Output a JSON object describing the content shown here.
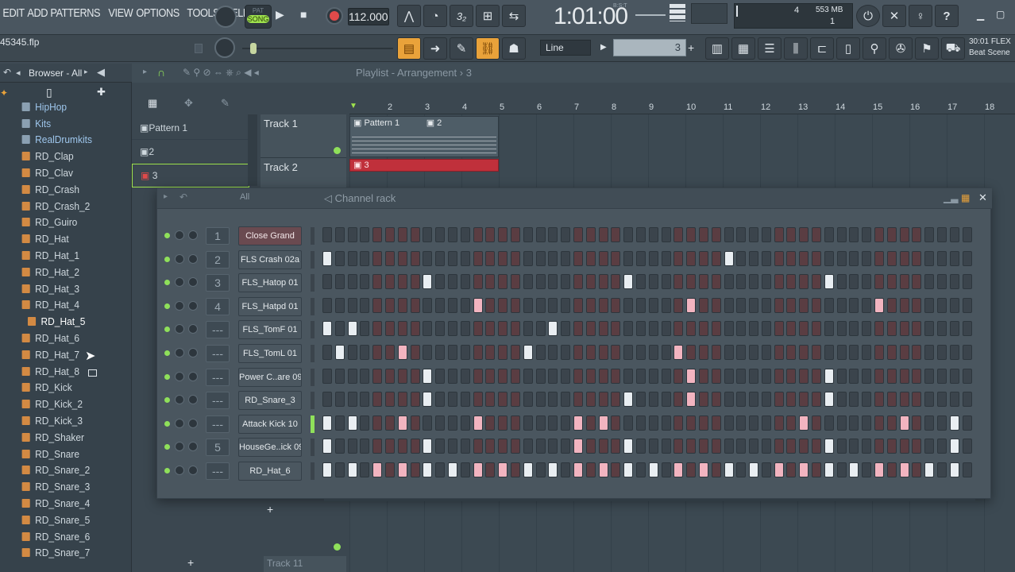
{
  "menu": [
    "EDIT",
    "ADD",
    "PATTERNS",
    "VIEW",
    "OPTIONS",
    "TOOLS",
    "HELP"
  ],
  "toolbar": {
    "pat_song": "SONG",
    "pat_label": "PAT",
    "tempo": "112.000",
    "time": "1:01:00",
    "time_sub": "B:S:T",
    "cpu_value": "4",
    "memory": "553 MB",
    "polyphony": "1",
    "snap_mode": "Line",
    "step_value": "3",
    "hint_time": "30:01",
    "hint_line1": "FLEX",
    "hint_line2": "Beat Scene",
    "file_name": "45345.flp",
    "help_label": "?"
  },
  "browser": {
    "title": "Browser - All",
    "items": [
      {
        "label": "HipHop",
        "kind": "folder"
      },
      {
        "label": "Kits",
        "kind": "folder"
      },
      {
        "label": "RealDrumkits",
        "kind": "folder"
      },
      {
        "label": "RD_Clap",
        "kind": "file"
      },
      {
        "label": "RD_Clav",
        "kind": "file"
      },
      {
        "label": "RD_Crash",
        "kind": "file"
      },
      {
        "label": "RD_Crash_2",
        "kind": "file"
      },
      {
        "label": "RD_Guiro",
        "kind": "file"
      },
      {
        "label": "RD_Hat",
        "kind": "file"
      },
      {
        "label": "RD_Hat_1",
        "kind": "file"
      },
      {
        "label": "RD_Hat_2",
        "kind": "file"
      },
      {
        "label": "RD_Hat_3",
        "kind": "file"
      },
      {
        "label": "RD_Hat_4",
        "kind": "file"
      },
      {
        "label": "RD_Hat_5",
        "kind": "selected"
      },
      {
        "label": "RD_Hat_6",
        "kind": "file"
      },
      {
        "label": "RD_Hat_7",
        "kind": "file"
      },
      {
        "label": "RD_Hat_8",
        "kind": "file"
      },
      {
        "label": "RD_Kick",
        "kind": "file"
      },
      {
        "label": "RD_Kick_2",
        "kind": "file"
      },
      {
        "label": "RD_Kick_3",
        "kind": "file"
      },
      {
        "label": "RD_Shaker",
        "kind": "file"
      },
      {
        "label": "RD_Snare",
        "kind": "file"
      },
      {
        "label": "RD_Snare_2",
        "kind": "file"
      },
      {
        "label": "RD_Snare_3",
        "kind": "file"
      },
      {
        "label": "RD_Snare_4",
        "kind": "file"
      },
      {
        "label": "RD_Snare_5",
        "kind": "file"
      },
      {
        "label": "RD_Snare_6",
        "kind": "file"
      },
      {
        "label": "RD_Snare_7",
        "kind": "file"
      }
    ]
  },
  "playlist": {
    "title": "Playlist - Arrangement",
    "pattern_selector": "3",
    "patterns": [
      "Pattern 1",
      "2",
      "3"
    ],
    "tracks": [
      "Track 1",
      "Track 2"
    ],
    "bottom_track": "Track 11",
    "ruler": [
      "2",
      "3",
      "4",
      "5",
      "6",
      "7",
      "8",
      "9",
      "10",
      "11",
      "12",
      "13",
      "14",
      "15",
      "16",
      "17",
      "18"
    ],
    "clips": [
      {
        "label": "Pattern 1"
      },
      {
        "label": "2"
      },
      {
        "label": "3"
      }
    ],
    "add_label": "+"
  },
  "channel_rack": {
    "title": "Channel rack",
    "filter": "All",
    "add_label": "+",
    "channels": [
      {
        "num": "1",
        "name": "Close Grand",
        "steps": []
      },
      {
        "num": "2",
        "name": "FLS Crash 02a",
        "steps": [
          0,
          32
        ]
      },
      {
        "num": "3",
        "name": "FLS_Hatop 01",
        "steps": [
          8,
          24,
          40
        ]
      },
      {
        "num": "4",
        "name": "FLS_Hatpd 01",
        "steps": [
          12,
          29,
          44
        ]
      },
      {
        "num": "---",
        "name": "FLS_TomF 01",
        "steps": [
          0,
          2,
          18
        ]
      },
      {
        "num": "---",
        "name": "FLS_TomL 01",
        "steps": [
          1,
          6,
          16,
          28
        ]
      },
      {
        "num": "---",
        "name": "Power C..are 09",
        "steps": [
          8,
          29,
          40
        ]
      },
      {
        "num": "---",
        "name": "RD_Snare_3",
        "steps": [
          8,
          24,
          29,
          40
        ]
      },
      {
        "num": "---",
        "name": "Attack Kick 10",
        "steps": [
          0,
          2,
          6,
          12,
          20,
          22,
          38,
          46,
          50
        ]
      },
      {
        "num": "5",
        "name": "HouseGe..ick 09",
        "steps": [
          0,
          8,
          20,
          24,
          40,
          50
        ]
      },
      {
        "num": "---",
        "name": "RD_Hat_6",
        "steps": [
          0,
          2,
          4,
          6,
          8,
          10,
          12,
          14,
          16,
          18,
          20,
          22,
          24,
          26,
          28,
          30,
          32,
          34,
          36,
          38,
          40,
          42,
          44,
          46,
          48,
          50
        ]
      }
    ]
  }
}
